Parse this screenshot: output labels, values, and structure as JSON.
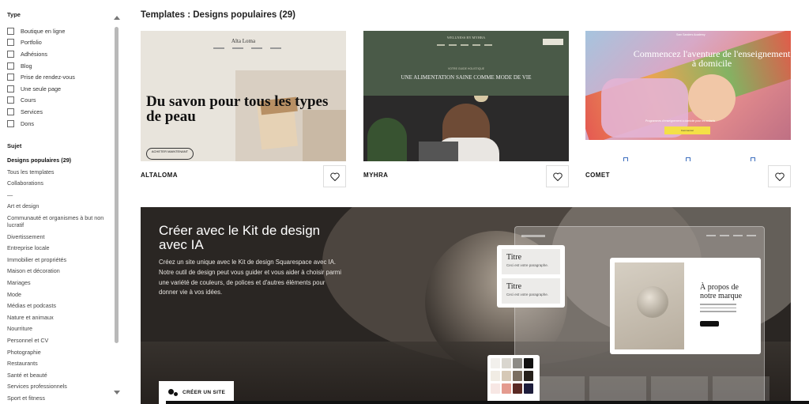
{
  "sidebar": {
    "type_title": "Type",
    "type_items": [
      {
        "label": "Boutique en ligne"
      },
      {
        "label": "Portfolio"
      },
      {
        "label": "Adhésions"
      },
      {
        "label": "Blog"
      },
      {
        "label": "Prise de rendez-vous"
      },
      {
        "label": "Une seule page"
      },
      {
        "label": "Cours"
      },
      {
        "label": "Services"
      },
      {
        "label": "Dons"
      }
    ],
    "sujet_title": "Sujet",
    "sujet_items": [
      {
        "label": "Designs populaires (29)"
      },
      {
        "label": "Tous les templates"
      },
      {
        "label": "Collaborations"
      },
      {
        "label": "—"
      },
      {
        "label": "Art et design"
      },
      {
        "label": "Communauté et organismes à but non lucratif"
      },
      {
        "label": "Divertissement"
      },
      {
        "label": "Entreprise locale"
      },
      {
        "label": "Immobilier et propriétés"
      },
      {
        "label": "Maison et décoration"
      },
      {
        "label": "Mariages"
      },
      {
        "label": "Mode"
      },
      {
        "label": "Médias et podcasts"
      },
      {
        "label": "Nature et animaux"
      },
      {
        "label": "Nourriture"
      },
      {
        "label": "Personnel et CV"
      },
      {
        "label": "Photographie"
      },
      {
        "label": "Restaurants"
      },
      {
        "label": "Santé et beauté"
      },
      {
        "label": "Services professionnels"
      },
      {
        "label": "Sport et fitness"
      }
    ]
  },
  "main": {
    "title": "Templates : Designs populaires (29)",
    "cards": [
      {
        "name": "ALTALOMA",
        "thumb": {
          "logo": "Alta Loma",
          "headline": "Du savon pour tous les types de peau",
          "button": "ACHETER MAINTENANT"
        }
      },
      {
        "name": "MYHRA",
        "thumb": {
          "brand": "WELLNESS BY MYHRA",
          "kicker": "VOTRE GUIDE HOLISTIQUE",
          "headline": "UNE ALIMENTATION SAINE COMME MODE DE VIE"
        }
      },
      {
        "name": "COMET",
        "thumb": {
          "brand": "Sam Sanders Academy",
          "headline": "Commencez l'aventure de l'enseignement à domicile",
          "small": "Programmes d'enseignement à domicile pour les enfants",
          "button": "Commencer"
        }
      }
    ]
  },
  "banner": {
    "title": "Créer avec le Kit de design avec IA",
    "text": "Créez un site unique avec le Kit de design Squarespace avec IA. Notre outil de design peut vous guider et vous aider à choisir parmi une variété de couleurs, de polices et d'autres éléments pour donner vie à vos idées.",
    "button": "CRÉER UN SITE",
    "mock": {
      "titre_1": "Titre",
      "titre_1_sub": "Ceci est votre paragraphe.",
      "titre_2": "Titre",
      "titre_2_sub": "Ceci est votre paragraphe.",
      "about_title": "À propos de notre marque"
    },
    "palette": [
      [
        "#f2f0ec",
        "#d9d6cf",
        "#8c8a85",
        "#111111"
      ],
      [
        "#f1ece4",
        "#d6c9b7",
        "#7b6e60",
        "#26201b"
      ],
      [
        "#f7e7e4",
        "#e49b8f",
        "#5a2a24",
        "#1d1d3b"
      ]
    ]
  },
  "colors": {
    "accent_text": "#222222",
    "banner_bg": "#2a2623",
    "border": "#dddddd"
  },
  "icons": {
    "heart": "heart-icon",
    "create": "dots-icon",
    "scroll_up": "chevron-up-icon",
    "scroll_down": "chevron-down-icon"
  }
}
